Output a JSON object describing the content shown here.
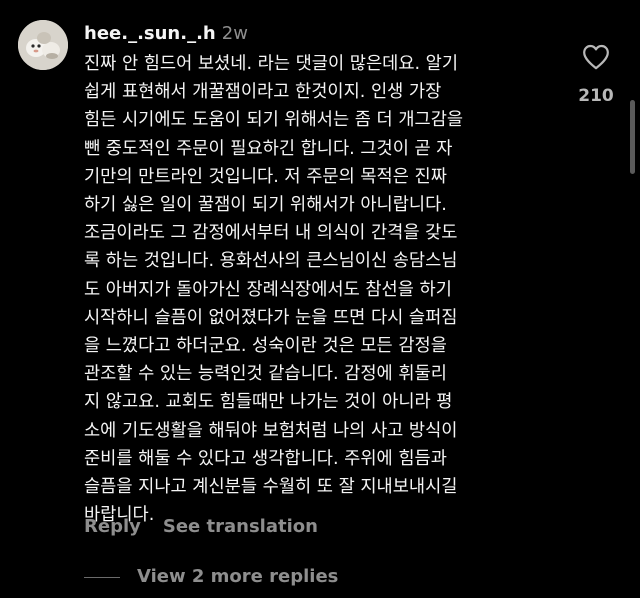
{
  "comment": {
    "username": "hee._.sun._.h",
    "timestamp": "2w",
    "lines": [
      "진짜 안 힘드어 보셨네. 라는 댓글이 많은데요. 알기",
      "쉽게 표현해서 개꿀잼이라고 한것이지. 인생 가장",
      "힘든 시기에도 도움이 되기 위해서는 좀 더 개그감을",
      "뺀 중도적인 주문이 필요하긴 합니다. 그것이 곧 자",
      "기만의 만트라인 것입니다. 저 주문의 목적은 진짜",
      "하기 싫은 일이 꿀잼이 되기 위해서가 아니랍니다.",
      "조금이라도 그 감정에서부터 내 의식이 간격을 갖도",
      "록 하는 것입니다. 용화선사의 큰스님이신 송담스님",
      "도 아버지가 돌아가신 장례식장에서도 참선을 하기",
      "시작하니 슬픔이 없어졌다가 눈을 뜨면 다시 슬퍼짐",
      "을 느꼈다고 하더군요. 성숙이란 것은 모든 감정을",
      "관조할 수 있는 능력인것 같습니다. 감정에 휘둘리",
      "지 않고요. 교회도 힘들때만 나가는 것이 아니라 평",
      "소에 기도생활을 해둬야 보험처럼 나의 사고 방식이",
      "준비를 해둘 수 있다고 생각합니다. 주위에 힘듬과",
      "슬픔을 지나고 계신분들 수월히 또 잘 지내보내시길",
      "바랍니다."
    ],
    "like_count": "210",
    "like_icon": "heart-outline-icon",
    "avatar_icon": "avatar-image"
  },
  "actions": {
    "reply_label": "Reply",
    "translate_label": "See translation"
  },
  "replies": {
    "label": "View 2 more replies"
  },
  "colors": {
    "background": "#000000",
    "primary_text": "#f5f5f5",
    "secondary_text": "#8e8e8e"
  }
}
